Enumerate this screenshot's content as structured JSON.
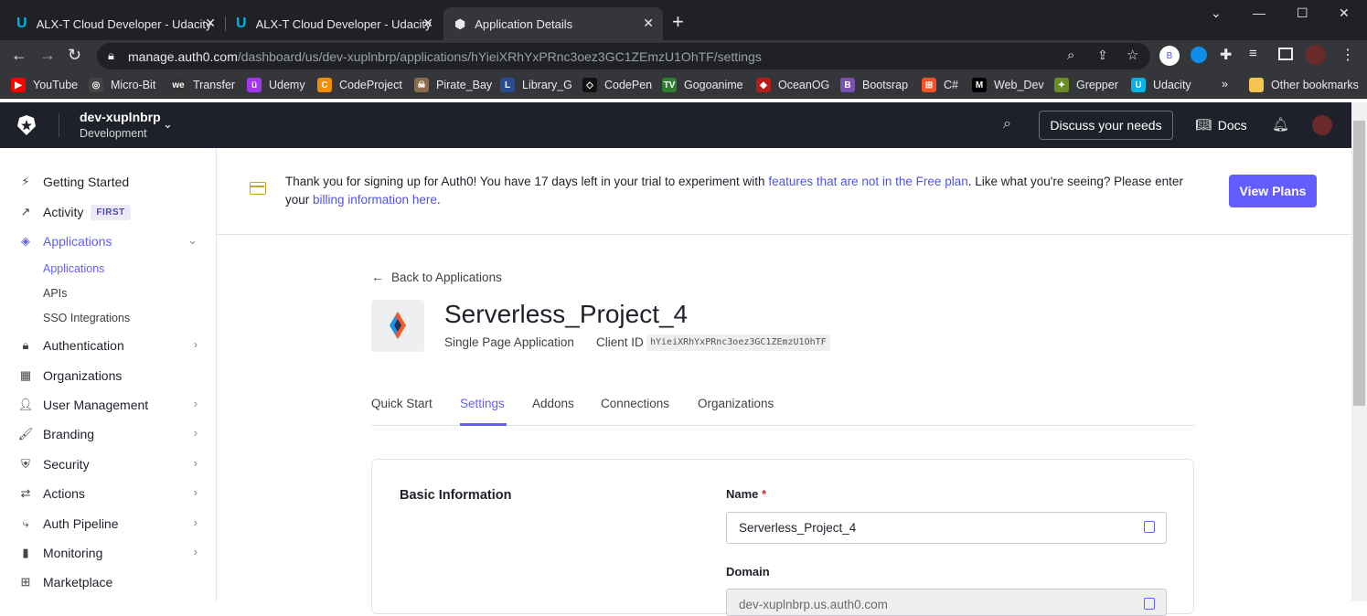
{
  "browser": {
    "tabs": [
      {
        "title": "ALX-T Cloud Developer - Udacity"
      },
      {
        "title": "ALX-T Cloud Developer - Udacity"
      },
      {
        "title": "Application Details"
      }
    ],
    "url_host": "manage.auth0.com",
    "url_path": "/dashboard/us/dev-xuplnbrp/applications/hYieiXRhYxPRnc3oez3GC1ZEmzU1OhTF/settings",
    "profile_initial": "B",
    "bookmarks": [
      {
        "label": "YouTube",
        "color": "#ff0000"
      },
      {
        "label": "Micro-Bit",
        "color": "#444444"
      },
      {
        "label": "Transfer",
        "color": "#333333"
      },
      {
        "label": "Udemy",
        "color": "#a435f0"
      },
      {
        "label": "CodeProject",
        "color": "#f28c00"
      },
      {
        "label": "Pirate_Bay",
        "color": "#8a6b4b"
      },
      {
        "label": "Library_G",
        "color": "#2a4d8f"
      },
      {
        "label": "CodePen",
        "color": "#111111"
      },
      {
        "label": "Gogoanime",
        "color": "#2e7d32"
      },
      {
        "label": "OceanOG",
        "color": "#b71c1c"
      },
      {
        "label": "Bootsrap",
        "color": "#7952b3"
      },
      {
        "label": "C#",
        "color": "#f35325"
      },
      {
        "label": "Web_Dev",
        "color": "#000000"
      },
      {
        "label": "Grepper",
        "color": "#6b8e23"
      },
      {
        "label": "Udacity",
        "color": "#02b3e4"
      }
    ],
    "overflow": "»",
    "other_bookmarks": "Other bookmarks"
  },
  "header": {
    "tenant_name": "dev-xuplnbrp",
    "environment": "Development",
    "discuss_label": "Discuss your needs",
    "docs_label": "Docs"
  },
  "sidebar": {
    "items": [
      {
        "label": "Getting Started",
        "icon": "bolt-icon"
      },
      {
        "label": "Activity",
        "badge": "FIRST",
        "icon": "activity-icon"
      },
      {
        "label": "Applications",
        "icon": "layers-icon"
      },
      {
        "label": "Authentication",
        "icon": "lock-icon"
      },
      {
        "label": "Organizations",
        "icon": "building-icon"
      },
      {
        "label": "User Management",
        "icon": "users-icon"
      },
      {
        "label": "Branding",
        "icon": "brush-icon"
      },
      {
        "label": "Security",
        "icon": "shield-icon"
      },
      {
        "label": "Actions",
        "icon": "actions-icon"
      },
      {
        "label": "Auth Pipeline",
        "icon": "pipeline-icon"
      },
      {
        "label": "Monitoring",
        "icon": "bar-chart-icon"
      },
      {
        "label": "Marketplace",
        "icon": "grid-icon"
      }
    ],
    "subitems": [
      {
        "label": "Applications"
      },
      {
        "label": "APIs"
      },
      {
        "label": "SSO Integrations"
      }
    ],
    "active_color": "#635dff"
  },
  "banner": {
    "text_1": "Thank you for signing up for Auth0! You have 17 days left in your trial to experiment with ",
    "link_1": "features that are not in the Free plan",
    "text_2": ". Like what you're seeing? Please enter your ",
    "link_2": "billing information here",
    "text_3": ".",
    "button": "View Plans"
  },
  "app": {
    "back_label": "Back to Applications",
    "name": "Serverless_Project_4",
    "type": "Single Page Application",
    "client_id_label": "Client ID",
    "client_id": "hYieiXRhYxPRnc3oez3GC1ZEmzU1OhTF",
    "tabs": [
      "Quick Start",
      "Settings",
      "Addons",
      "Connections",
      "Organizations"
    ],
    "active_tab": "Settings"
  },
  "basic_info": {
    "section_title": "Basic Information",
    "name_label": "Name",
    "required_mark": "*",
    "name_value": "Serverless_Project_4",
    "domain_label": "Domain",
    "domain_value": "dev-xuplnbrp.us.auth0.com"
  }
}
